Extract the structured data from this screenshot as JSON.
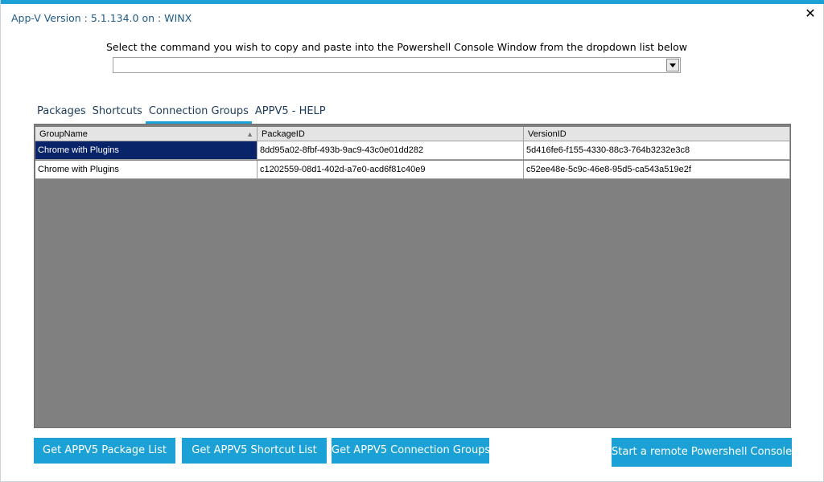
{
  "window": {
    "title": "App-V Version : 5.1.134.0 on : WINX",
    "close_glyph": "✕",
    "accent_color": "#1ba1d6"
  },
  "command": {
    "instruction": "Select the command you wish to copy and paste into the Powershell Console Window from the dropdown list below",
    "selected_value": ""
  },
  "tabs": [
    {
      "label": "Packages",
      "active": false
    },
    {
      "label": "Shortcuts",
      "active": false
    },
    {
      "label": "Connection Groups",
      "active": true
    },
    {
      "label": "APPV5 - HELP",
      "active": false
    }
  ],
  "grid": {
    "columns": [
      "GroupName",
      "PackageID",
      "VersionID"
    ],
    "sort_glyph": "▲",
    "rows": [
      {
        "GroupName": "Chrome with Plugins",
        "PackageID": "8dd95a02-8fbf-493b-9ac9-43c0e01dd282",
        "VersionID": "5d416fe6-f155-4330-88c3-764b3232e3c8"
      },
      {
        "GroupName": "Chrome with Plugins",
        "PackageID": "c1202559-08d1-402d-a7e0-acd6f81c40e9",
        "VersionID": "c52ee48e-5c9c-46e8-95d5-ca543a519e2f"
      }
    ],
    "selection_color": "#0a246a"
  },
  "buttons": {
    "package_list": "Get APPV5 Package List",
    "shortcut_list": "Get APPV5 Shortcut List",
    "connection_groups": "Get APPV5 Connection Groups",
    "remote_console": "Start a remote Powershell Console"
  }
}
